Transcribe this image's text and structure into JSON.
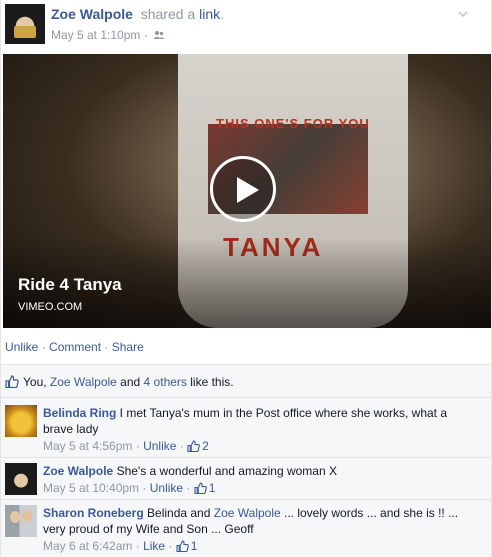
{
  "post": {
    "author": "Zoe Walpole",
    "verb": "shared a",
    "object_link": "link",
    "period": ".",
    "timestamp": "May 5 at 1:10pm",
    "audience_icon": "friends-icon"
  },
  "video": {
    "title": "Ride 4 Tanya",
    "source": "VIMEO.COM",
    "shirt_top_text": "THIS ONE'S FOR YOU",
    "shirt_name_text": "TANYA"
  },
  "actions": {
    "unlike": "Unlike",
    "comment": "Comment",
    "share": "Share",
    "dot": " · "
  },
  "likes": {
    "prefix": "You, ",
    "name": "Zoe Walpole",
    "middle": " and ",
    "others": "4 others",
    "suffix": " like this."
  },
  "comments": [
    {
      "name": "Belinda Ring",
      "text": " I met Tanya's mum in the Post office where she works, what a brave lady",
      "time": "May 5 at 4:56pm",
      "action": "Unlike",
      "like_count": "2"
    },
    {
      "name": "Zoe Walpole",
      "text": " She's a wonderful and amazing woman X",
      "time": "May 5 at 10:40pm",
      "action": "Unlike",
      "like_count": "1"
    },
    {
      "name": "Sharon Roneberg",
      "text_pre": " Belinda and ",
      "tag": "Zoe Walpole",
      "text_post": " ... lovely words ... and she is !! ... very proud of my Wife and Son ... Geoff",
      "time": "May 6 at 6:42am",
      "action": "Like",
      "like_count": "1"
    }
  ],
  "colors": {
    "link": "#3b5998",
    "muted": "#9197a3",
    "ufi_bg": "#f6f7f8"
  }
}
